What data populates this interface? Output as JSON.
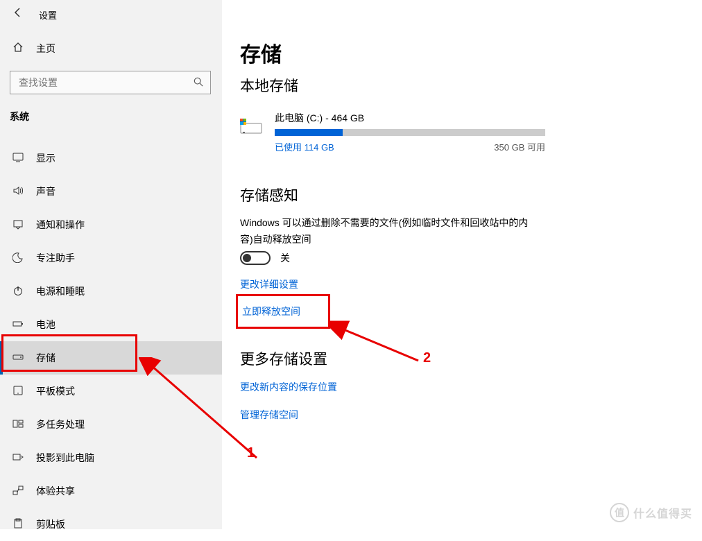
{
  "header": {
    "title": "设置"
  },
  "home": {
    "label": "主页"
  },
  "search": {
    "placeholder": "查找设置"
  },
  "group": {
    "label": "系统"
  },
  "nav": [
    {
      "icon": "display",
      "label": "显示"
    },
    {
      "icon": "sound",
      "label": "声音"
    },
    {
      "icon": "notify",
      "label": "通知和操作"
    },
    {
      "icon": "focus",
      "label": "专注助手"
    },
    {
      "icon": "power",
      "label": "电源和睡眠"
    },
    {
      "icon": "battery",
      "label": "电池"
    },
    {
      "icon": "storage",
      "label": "存储"
    },
    {
      "icon": "tablet",
      "label": "平板模式"
    },
    {
      "icon": "multitask",
      "label": "多任务处理"
    },
    {
      "icon": "project",
      "label": "投影到此电脑"
    },
    {
      "icon": "share",
      "label": "体验共享"
    },
    {
      "icon": "clipboard",
      "label": "剪贴板"
    }
  ],
  "nav_selected_index": 6,
  "page": {
    "title": "存储",
    "local_title": "本地存储",
    "drive": {
      "name": "此电脑 (C:) - 464 GB",
      "used_pct": 25,
      "used_label": "已使用 114 GB",
      "free_label": "350 GB 可用"
    },
    "sense_title": "存储感知",
    "sense_desc": "Windows 可以通过删除不需要的文件(例如临时文件和回收站中的内容)自动释放空间",
    "toggle_state": "off",
    "toggle_label": "关",
    "link_change": "更改详细设置",
    "link_free": "立即释放空间",
    "more_title": "更多存储设置",
    "link_loc": "更改新内容的保存位置",
    "link_mgr": "管理存储空间"
  },
  "annotations": {
    "num1": "1",
    "num2": "2"
  },
  "watermark": {
    "symbol": "值",
    "text": "什么值得买"
  }
}
